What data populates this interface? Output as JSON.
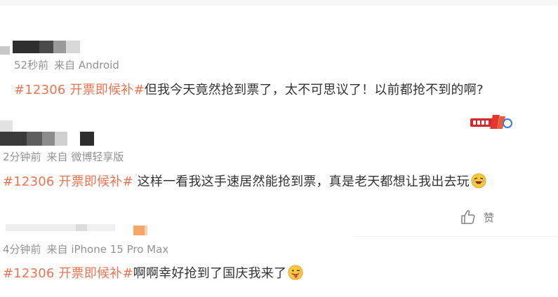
{
  "comments": [
    {
      "time": "52秒前",
      "source": "来自 Android",
      "hashtag": "#12306 开票即候补#",
      "text": "但我今天竟然抢到票了，太不可思议了！以前都抢不到的啊?"
    },
    {
      "time": "2分钟前",
      "source": "来自 微博轻享版",
      "hashtag": "#12306 开票即候补#",
      "text": " 这样一看我这手速居然能抢到票，真是老天都想让我出去玩",
      "emoji": "laughing-face-emoji"
    },
    {
      "time": "4分钟前",
      "source": "来自 iPhone 15 Pro Max",
      "hashtag": "#12306 开票即候补#",
      "text": "啊啊幸好抢到了国庆我来了",
      "emoji": "tongue-out-face-emoji"
    }
  ],
  "like": {
    "label": "赞",
    "icon": "thumbs-up-icon"
  },
  "colors": {
    "hashtag": "#eb7350",
    "meta": "#939393",
    "text": "#333333"
  }
}
